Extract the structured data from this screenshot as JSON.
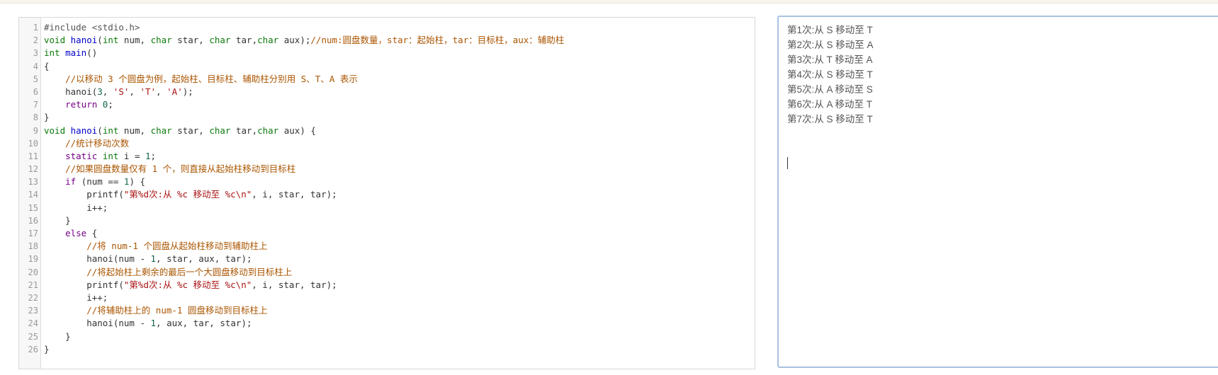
{
  "editor": {
    "lines": [
      {
        "n": "1",
        "tokens": [
          {
            "t": "#include <stdio.h>",
            "c": "pre"
          }
        ]
      },
      {
        "n": "2",
        "tokens": [
          {
            "t": "void ",
            "c": "kw"
          },
          {
            "t": "hanoi",
            "c": "fn"
          },
          {
            "t": "(",
            "c": "plain"
          },
          {
            "t": "int ",
            "c": "kw"
          },
          {
            "t": "num, ",
            "c": "plain"
          },
          {
            "t": "char ",
            "c": "kw"
          },
          {
            "t": "star, ",
            "c": "plain"
          },
          {
            "t": "char ",
            "c": "kw"
          },
          {
            "t": "tar,",
            "c": "plain"
          },
          {
            "t": "char ",
            "c": "kw"
          },
          {
            "t": "aux);",
            "c": "plain"
          },
          {
            "t": "//num:圆盘数量，star：起始柱，tar：目标柱，aux：辅助柱",
            "c": "cm"
          }
        ]
      },
      {
        "n": "3",
        "tokens": [
          {
            "t": "int ",
            "c": "kw"
          },
          {
            "t": "main",
            "c": "fn"
          },
          {
            "t": "()",
            "c": "plain"
          }
        ]
      },
      {
        "n": "4",
        "tokens": [
          {
            "t": "{",
            "c": "plain"
          }
        ]
      },
      {
        "n": "5",
        "tokens": [
          {
            "t": "    ",
            "c": "plain"
          },
          {
            "t": "//以移动 3 个圆盘为例，起始柱、目标柱、辅助柱分别用 S、T、A 表示",
            "c": "cm"
          }
        ]
      },
      {
        "n": "6",
        "tokens": [
          {
            "t": "    hanoi(",
            "c": "plain"
          },
          {
            "t": "3",
            "c": "num"
          },
          {
            "t": ", ",
            "c": "plain"
          },
          {
            "t": "'S'",
            "c": "str"
          },
          {
            "t": ", ",
            "c": "plain"
          },
          {
            "t": "'T'",
            "c": "str"
          },
          {
            "t": ", ",
            "c": "plain"
          },
          {
            "t": "'A'",
            "c": "str"
          },
          {
            "t": ");",
            "c": "plain"
          }
        ]
      },
      {
        "n": "7",
        "tokens": [
          {
            "t": "    ",
            "c": "plain"
          },
          {
            "t": "return ",
            "c": "kw2"
          },
          {
            "t": "0",
            "c": "num"
          },
          {
            "t": ";",
            "c": "plain"
          }
        ]
      },
      {
        "n": "8",
        "tokens": [
          {
            "t": "}",
            "c": "plain"
          }
        ]
      },
      {
        "n": "9",
        "tokens": [
          {
            "t": "void ",
            "c": "kw"
          },
          {
            "t": "hanoi",
            "c": "fn"
          },
          {
            "t": "(",
            "c": "plain"
          },
          {
            "t": "int ",
            "c": "kw"
          },
          {
            "t": "num, ",
            "c": "plain"
          },
          {
            "t": "char ",
            "c": "kw"
          },
          {
            "t": "star, ",
            "c": "plain"
          },
          {
            "t": "char ",
            "c": "kw"
          },
          {
            "t": "tar,",
            "c": "plain"
          },
          {
            "t": "char ",
            "c": "kw"
          },
          {
            "t": "aux) {",
            "c": "plain"
          }
        ]
      },
      {
        "n": "10",
        "tokens": [
          {
            "t": "    ",
            "c": "plain"
          },
          {
            "t": "//统计移动次数",
            "c": "cm"
          }
        ]
      },
      {
        "n": "11",
        "tokens": [
          {
            "t": "    ",
            "c": "plain"
          },
          {
            "t": "static ",
            "c": "kw2"
          },
          {
            "t": "int ",
            "c": "kw"
          },
          {
            "t": "i = ",
            "c": "plain"
          },
          {
            "t": "1",
            "c": "num"
          },
          {
            "t": ";",
            "c": "plain"
          }
        ]
      },
      {
        "n": "12",
        "tokens": [
          {
            "t": "    ",
            "c": "plain"
          },
          {
            "t": "//如果圆盘数量仅有 1 个，则直接从起始柱移动到目标柱",
            "c": "cm"
          }
        ]
      },
      {
        "n": "13",
        "tokens": [
          {
            "t": "    ",
            "c": "plain"
          },
          {
            "t": "if ",
            "c": "kw2"
          },
          {
            "t": "(num == ",
            "c": "plain"
          },
          {
            "t": "1",
            "c": "num"
          },
          {
            "t": ") {",
            "c": "plain"
          }
        ]
      },
      {
        "n": "14",
        "tokens": [
          {
            "t": "        printf(",
            "c": "plain"
          },
          {
            "t": "\"第%d次:从 %c 移动至 %c\\n\"",
            "c": "str"
          },
          {
            "t": ", i, star, tar);",
            "c": "plain"
          }
        ]
      },
      {
        "n": "15",
        "tokens": [
          {
            "t": "        i++;",
            "c": "plain"
          }
        ]
      },
      {
        "n": "16",
        "tokens": [
          {
            "t": "    }",
            "c": "plain"
          }
        ]
      },
      {
        "n": "17",
        "tokens": [
          {
            "t": "    ",
            "c": "plain"
          },
          {
            "t": "else ",
            "c": "kw2"
          },
          {
            "t": "{",
            "c": "plain"
          }
        ]
      },
      {
        "n": "18",
        "tokens": [
          {
            "t": "        ",
            "c": "plain"
          },
          {
            "t": "//将 num-1 个圆盘从起始柱移动到辅助柱上",
            "c": "cm"
          }
        ]
      },
      {
        "n": "19",
        "tokens": [
          {
            "t": "        hanoi(num - ",
            "c": "plain"
          },
          {
            "t": "1",
            "c": "num"
          },
          {
            "t": ", star, aux, tar);",
            "c": "plain"
          }
        ]
      },
      {
        "n": "20",
        "tokens": [
          {
            "t": "        ",
            "c": "plain"
          },
          {
            "t": "//将起始柱上剩余的最后一个大圆盘移动到目标柱上",
            "c": "cm"
          }
        ]
      },
      {
        "n": "21",
        "tokens": [
          {
            "t": "        printf(",
            "c": "plain"
          },
          {
            "t": "\"第%d次:从 %c 移动至 %c\\n\"",
            "c": "str"
          },
          {
            "t": ", i, star, tar);",
            "c": "plain"
          }
        ]
      },
      {
        "n": "22",
        "tokens": [
          {
            "t": "        i++;",
            "c": "plain"
          }
        ]
      },
      {
        "n": "23",
        "tokens": [
          {
            "t": "        ",
            "c": "plain"
          },
          {
            "t": "//将辅助柱上的 num-1 圆盘移动到目标柱上",
            "c": "cm"
          }
        ]
      },
      {
        "n": "24",
        "tokens": [
          {
            "t": "        hanoi(num - ",
            "c": "plain"
          },
          {
            "t": "1",
            "c": "num"
          },
          {
            "t": ", aux, tar, star);",
            "c": "plain"
          }
        ]
      },
      {
        "n": "25",
        "tokens": [
          {
            "t": "    }",
            "c": "plain"
          }
        ]
      },
      {
        "n": "26",
        "tokens": [
          {
            "t": "}",
            "c": "plain"
          }
        ]
      }
    ]
  },
  "output": {
    "lines": [
      "第1次:从 S 移动至 T",
      "第2次:从 S 移动至 A",
      "第3次:从 T 移动至 A",
      "第4次:从 S 移动至 T",
      "第5次:从 A 移动至 S",
      "第6次:从 A 移动至 T",
      "第7次:从 S 移动至 T"
    ]
  },
  "colors": {
    "keyword": "#0b7a0b",
    "control_keyword": "#770088",
    "function_name": "#0000cc",
    "comment": "#aa5500",
    "string": "#aa1111",
    "number": "#116644",
    "output_border": "#a8c1e0"
  }
}
